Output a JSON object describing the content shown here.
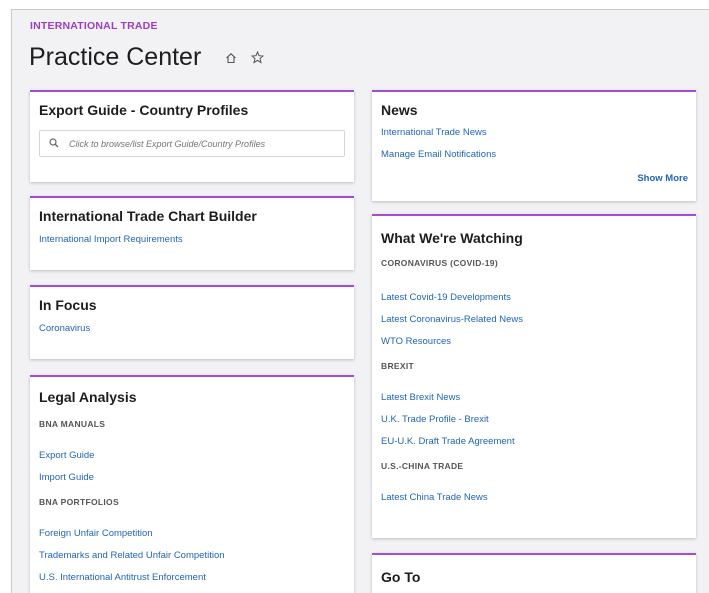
{
  "header": {
    "section_label": "INTERNATIONAL TRADE",
    "page_title": "Practice Center"
  },
  "icons": {
    "home": "home-icon",
    "favorite": "star-icon",
    "search": "search-icon"
  },
  "colors": {
    "accent": "#a24ed0",
    "link": "#1f66b0",
    "label": "#9b3fc0"
  },
  "export_guide": {
    "title": "Export Guide - Country Profiles",
    "search_placeholder": "Click to browse/list Export Guide/Country Profiles"
  },
  "chart_builder": {
    "title": "International Trade Chart Builder",
    "link": "International Import Requirements"
  },
  "in_focus": {
    "title": "In Focus",
    "link": "Coronavirus"
  },
  "legal_analysis": {
    "title": "Legal Analysis",
    "bna_manuals_heading": "BNA MANUALS",
    "manual_links": [
      "Export Guide",
      "Import Guide"
    ],
    "bna_portfolios_heading": "BNA PORTFOLIOS",
    "portfolio_links": [
      "Foreign Unfair Competition",
      "Trademarks and Related Unfair Competition",
      "U.S. International Antitrust Enforcement"
    ]
  },
  "news": {
    "title": "News",
    "links": [
      "International Trade News",
      "Manage Email Notifications"
    ],
    "show_more": "Show More"
  },
  "watching": {
    "title": "What We're Watching",
    "covid_heading": "CORONAVIRUS (COVID-19)",
    "covid_links": [
      "Latest Covid-19 Developments",
      "Latest Coronavirus-Related News",
      "WTO Resources"
    ],
    "brexit_heading": "BREXIT",
    "brexit_links": [
      "Latest Brexit News",
      "U.K. Trade Profile - Brexit",
      "EU-U.K. Draft Trade Agreement"
    ],
    "china_heading": "U.S.-CHINA TRADE",
    "china_links": [
      "Latest China Trade News"
    ]
  },
  "goto": {
    "title": "Go To"
  }
}
